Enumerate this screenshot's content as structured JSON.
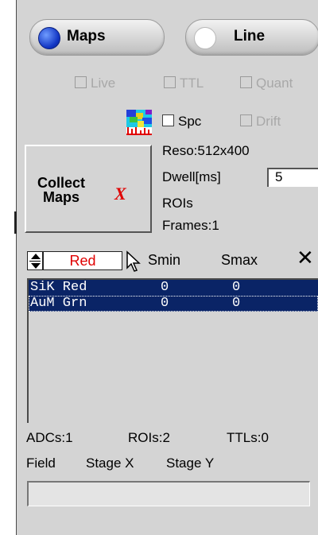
{
  "mode": {
    "maps": {
      "label": "Maps",
      "selected": true
    },
    "line": {
      "label": "Line",
      "selected": false
    }
  },
  "options": {
    "live": "Live",
    "ttl": "TTL",
    "quant": "Quant",
    "spc": "Spc",
    "drift": "Drift"
  },
  "collect": {
    "line1": "Collect",
    "line2": "Maps",
    "x_mark": "X"
  },
  "info": {
    "reso": "Reso:512x400",
    "dwell_label": "Dwell[ms]",
    "dwell_value": "5",
    "rois": "ROIs",
    "frames": "Frames:1"
  },
  "table": {
    "color_select": "Red",
    "col_smin": "Smin",
    "col_smax": "Smax",
    "close_glyph": "✕",
    "rows": [
      {
        "name": "SiK Red",
        "smin": "0",
        "smax": "0"
      },
      {
        "name": "AuM Grn",
        "smin": "0",
        "smax": "0"
      }
    ]
  },
  "footer": {
    "adcs": "ADCs:1",
    "rois": "ROIs:2",
    "ttls": "TTLs:0",
    "field": "Field",
    "stage_x": "Stage X",
    "stage_y": "Stage Y"
  },
  "colors": {
    "selection": "#0a2466",
    "accent_red": "#e00000",
    "radio_on": "#1236c4"
  }
}
